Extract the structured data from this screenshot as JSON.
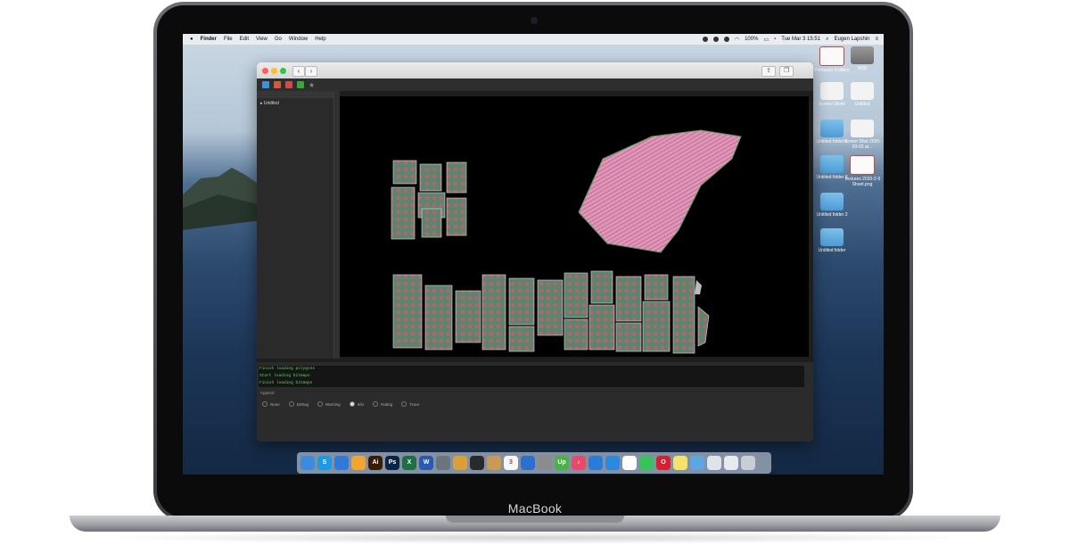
{
  "device": {
    "label": "MacBook"
  },
  "menubar": {
    "items": [
      "Finder",
      "File",
      "Edit",
      "View",
      "Go",
      "Window",
      "Help"
    ],
    "battery": "100%",
    "datetime": "Tue Mar 3  15:51",
    "user": "Eugen Lapshin"
  },
  "desktop": {
    "icons": [
      {
        "label": "Firmware Folders",
        "kind": "sheet"
      },
      {
        "label": "HDD",
        "kind": "disk"
      },
      {
        "label": "Screen Shots",
        "kind": "doc"
      },
      {
        "label": "Untitled",
        "kind": "doc"
      },
      {
        "label": "Untitled folder 4",
        "kind": "folder"
      },
      {
        "label": "Screen Shot 2020-03-03 at...",
        "kind": "doc"
      },
      {
        "label": "Untitled folder 3",
        "kind": "folder"
      },
      {
        "label": "Textures 2020-2-9 Sheet.png",
        "kind": "sheet"
      },
      {
        "label": "Untitled folder 2",
        "kind": "folder"
      },
      {
        "label": "Untitled folder",
        "kind": "folder"
      }
    ]
  },
  "app_window": {
    "panel": {
      "tree_item": "Untitled"
    },
    "log_lines": [
      "Finish loading polygons",
      "Start loading bitmaps",
      "Finish loading bitmaps"
    ],
    "filter_label": "Append",
    "radios": [
      {
        "label": "None",
        "on": false
      },
      {
        "label": "Debug",
        "on": false
      },
      {
        "label": "Warning",
        "on": false
      },
      {
        "label": "Info",
        "on": true
      },
      {
        "label": "Rating",
        "on": false
      },
      {
        "label": "Trace",
        "on": false
      }
    ]
  },
  "dock": {
    "apps": [
      {
        "icon": "finder-icon",
        "color": "#3d8be0",
        "glyph": ""
      },
      {
        "icon": "skype-icon",
        "color": "#1b9be6",
        "glyph": "S"
      },
      {
        "icon": "safari-icon",
        "color": "#2f7ad9",
        "glyph": ""
      },
      {
        "icon": "sketch-icon",
        "color": "#f1a633",
        "glyph": ""
      },
      {
        "icon": "illustrator-icon",
        "color": "#3a1b05",
        "glyph": "Ai"
      },
      {
        "icon": "photoshop-icon",
        "color": "#0b2644",
        "glyph": "Ps"
      },
      {
        "icon": "excel-icon",
        "color": "#1e7044",
        "glyph": "X"
      },
      {
        "icon": "word-icon",
        "color": "#285ab2",
        "glyph": "W"
      },
      {
        "icon": "image-icon",
        "color": "#6a7580",
        "glyph": ""
      },
      {
        "icon": "sketchbook-icon",
        "color": "#d9a03a",
        "glyph": ""
      },
      {
        "icon": "terminal-icon",
        "color": "#2a2a2a",
        "glyph": ""
      },
      {
        "icon": "notes-icon",
        "color": "#c99a53",
        "glyph": ""
      },
      {
        "icon": "calendar-icon",
        "color": "#f7f7f7",
        "glyph": "3"
      },
      {
        "icon": "xcode-icon",
        "color": "#2c6fd0",
        "glyph": ""
      },
      {
        "icon": "preview-icon",
        "color": "#8c8c8c",
        "glyph": ""
      },
      {
        "icon": "upwork-icon",
        "color": "#49b244",
        "glyph": "Up"
      },
      {
        "icon": "music-icon",
        "color": "#ea4a69",
        "glyph": "♪"
      },
      {
        "icon": "mail-icon",
        "color": "#2b7cd9",
        "glyph": ""
      },
      {
        "icon": "appstore-icon",
        "color": "#2a8ae0",
        "glyph": ""
      },
      {
        "icon": "slack-icon",
        "color": "#ffffff",
        "glyph": ""
      },
      {
        "icon": "whatsapp-icon",
        "color": "#36c35a",
        "glyph": ""
      },
      {
        "icon": "opera-icon",
        "color": "#d4202f",
        "glyph": "O"
      },
      {
        "icon": "stickies-icon",
        "color": "#f5e26b",
        "glyph": ""
      },
      {
        "icon": "folder-icon",
        "color": "#5ba6e3",
        "glyph": ""
      },
      {
        "icon": "downloads-icon",
        "color": "#dfe4ea",
        "glyph": ""
      },
      {
        "icon": "documents-icon",
        "color": "#e7ebef",
        "glyph": ""
      },
      {
        "icon": "trash-icon",
        "color": "#c9ced4",
        "glyph": ""
      }
    ]
  }
}
